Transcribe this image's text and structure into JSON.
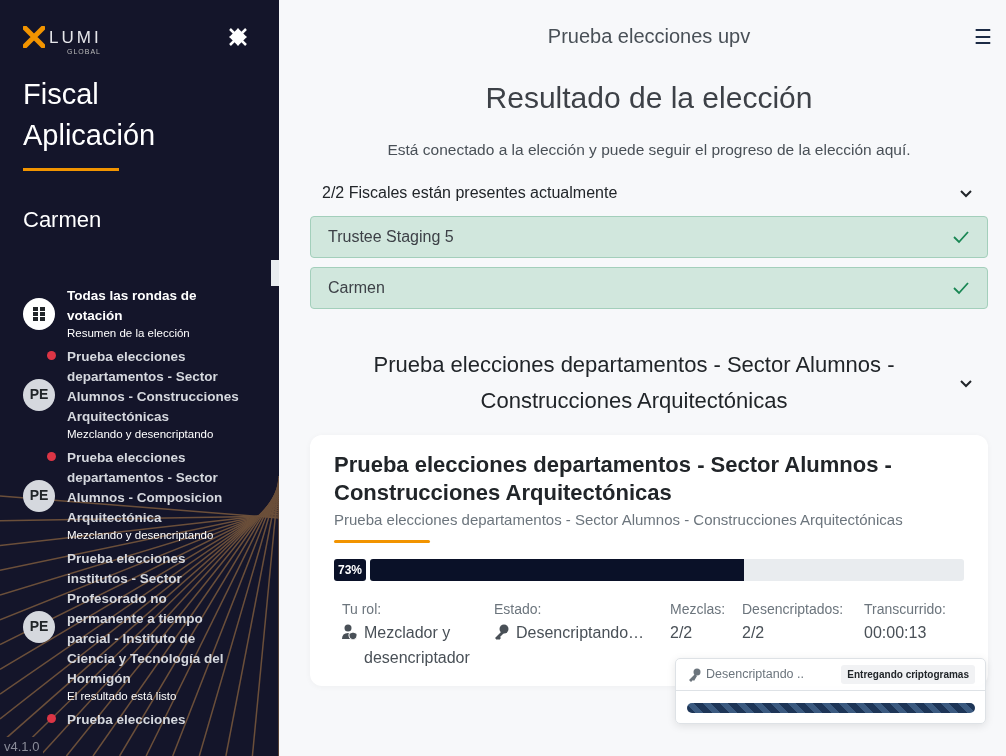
{
  "sidebar": {
    "logo": {
      "name": "LUMI",
      "tagline": "GLOBAL"
    },
    "title": "Fiscal Aplicación",
    "user": "Carmen",
    "items": [
      {
        "kind": "overview",
        "title": "Todas las rondas de votación",
        "subtitle": "Resumen de la elección",
        "notification": false
      },
      {
        "kind": "election",
        "avatar": "PE",
        "title": "Prueba elecciones departamentos - Sector Alumnos - Construcciones Arquitectónicas",
        "subtitle": "Mezclando y desencriptando",
        "notification": true
      },
      {
        "kind": "election",
        "avatar": "PE",
        "title": "Prueba elecciones departamentos - Sector Alumnos - Composicion Arquitectónica",
        "subtitle": "Mezclando y desencriptando",
        "notification": true
      },
      {
        "kind": "election",
        "avatar": "PE",
        "title": "Prueba elecciones institutos - Sector Profesorado no permanente a tiempo parcial - Instituto de Ciencia y Tecnología del Hormigón",
        "subtitle": "El resultado está listo",
        "notification": false
      },
      {
        "kind": "cut",
        "title": "Prueba elecciones",
        "notification": true
      }
    ],
    "version": "v4.1.0"
  },
  "header": {
    "title": "Prueba elecciones upv",
    "menu": "☰"
  },
  "page": {
    "title": "Resultado de la elección",
    "intro": "Está conectado a la elección y puede seguir el progreso de la elección aquí."
  },
  "trustees": {
    "summary": "2/2 Fiscales están presentes actualmente",
    "expanded": true,
    "items": [
      {
        "name": "Trustee Staging 5",
        "present": true
      },
      {
        "name": "Carmen",
        "present": true
      }
    ]
  },
  "election": {
    "heading": "Prueba elecciones departamentos - Sector Alumnos - Construcciones Arquitectónicas",
    "expanded": true,
    "card": {
      "title": "Prueba elecciones departamentos - Sector Alumnos - Construcciones Arquitectónicas",
      "subtitle": "Prueba elecciones departamentos - Sector Alumnos - Construcciones Arquitectónicas",
      "percent": "73%",
      "level": 0.63,
      "stats": [
        {
          "kind": "role",
          "label": "Tu rol:",
          "value": "Mezclador y desencriptador"
        },
        {
          "kind": "state",
          "label": "Estado:",
          "value": "Desencriptando…"
        },
        {
          "kind": "plain",
          "label": "Mezclas:",
          "value": "2/2"
        },
        {
          "kind": "plain",
          "label": "Desencriptados:",
          "value": "2/2"
        },
        {
          "kind": "plain",
          "label": "Transcurrido:",
          "value": "00:00:13"
        }
      ]
    },
    "popover": {
      "status": "Desencriptando ..",
      "badge": "Entregando criptogramas",
      "level": 1
    }
  }
}
